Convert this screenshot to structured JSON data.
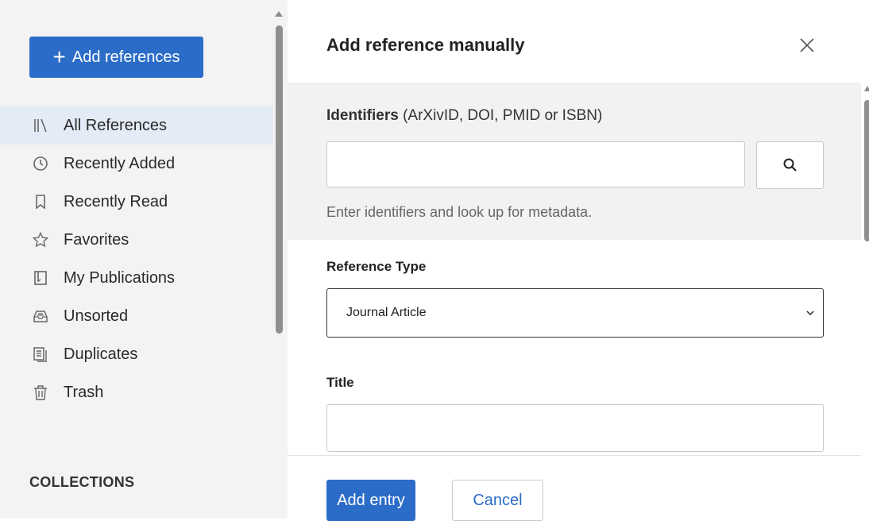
{
  "sidebar": {
    "add_button_label": "Add references",
    "items": [
      {
        "label": "All References",
        "icon": "library-icon",
        "active": true
      },
      {
        "label": "Recently Added",
        "icon": "clock-icon"
      },
      {
        "label": "Recently Read",
        "icon": "bookmark-icon"
      },
      {
        "label": "Favorites",
        "icon": "star-icon"
      },
      {
        "label": "My Publications",
        "icon": "publication-icon"
      },
      {
        "label": "Unsorted",
        "icon": "inbox-icon"
      },
      {
        "label": "Duplicates",
        "icon": "duplicates-icon"
      },
      {
        "label": "Trash",
        "icon": "trash-icon"
      }
    ],
    "collections_heading": "COLLECTIONS"
  },
  "dialog": {
    "title": "Add reference manually",
    "identifiers": {
      "label_bold": "Identifiers",
      "label_rest": " (ArXivID, DOI, PMID or ISBN)",
      "value": "",
      "hint": "Enter identifiers and look up for metadata."
    },
    "reference_type": {
      "label": "Reference Type",
      "selected": "Journal Article"
    },
    "title_field": {
      "label": "Title",
      "value": ""
    },
    "add_entry_label": "Add entry",
    "cancel_label": "Cancel"
  },
  "colors": {
    "accent": "#2b6cc8",
    "sidebar_bg": "#f3f3f3",
    "active_item_bg": "#e3ebf6"
  }
}
